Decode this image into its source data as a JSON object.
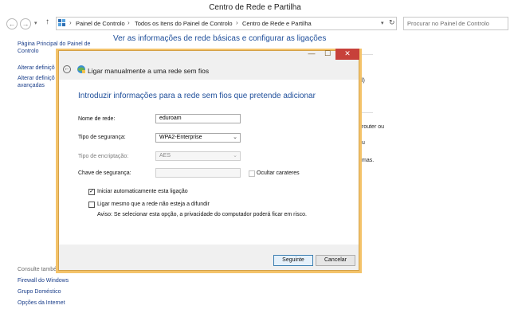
{
  "window": {
    "title": "Centro de Rede e Partilha",
    "nav": {
      "back": "←",
      "forward": "→",
      "dropdown": "▾",
      "up": "↑"
    },
    "breadcrumb": {
      "items": [
        "Painel de Controlo",
        "Todos os Itens do Painel de Controlo",
        "Centro de Rede e Partilha"
      ],
      "separator": "›",
      "dropdown": "▾",
      "refresh": "↻"
    },
    "search_placeholder": "Procurar no Painel de Controlo"
  },
  "sidebar": {
    "home_link": [
      "Página Principal do Painel de",
      "Controlo"
    ],
    "links": [
      "Alterar definiçõ",
      "Alterar definiçõ",
      "avançadas"
    ],
    "see_also": "Consulte també",
    "see_also_links": [
      "Firewall do Windows",
      "Grupo Doméstico",
      "Opções da Internet"
    ]
  },
  "main": {
    "heading": "Ver as informações de rede básicas e configurar as ligações",
    "fragments": [
      "l)",
      "router ou",
      "u",
      "mas."
    ]
  },
  "dialog": {
    "title": "Ligar manualmente a uma rede sem fios",
    "controls": {
      "minimize": "—",
      "maximize": "☐",
      "close": "✕"
    },
    "back": "←",
    "heading": "Introduzir informações para a rede sem fios que pretende adicionar",
    "fields": {
      "network_name": {
        "label": "Nome de rede:",
        "value": "eduroam"
      },
      "security_type": {
        "label": "Tipo de segurança:",
        "value": "WPA2-Enterprise"
      },
      "encryption_type": {
        "label": "Tipo de encriptação:",
        "value": "AES"
      },
      "security_key": {
        "label": "Chave de segurança:",
        "value": ""
      },
      "hide_chars": {
        "label": "Ocultar carateres",
        "checked": false
      }
    },
    "options": {
      "auto_start": {
        "label": "Iniciar automaticamente esta ligação",
        "checked": true
      },
      "connect_hidden": {
        "label": "Ligar mesmo que a rede não esteja a difundir",
        "checked": false
      },
      "warning": "Aviso: Se selecionar esta opção, a privacidade do computador poderá ficar em risco."
    },
    "buttons": {
      "next": "Seguinte",
      "cancel": "Cancelar"
    }
  },
  "icons": {
    "select_arrow": "⌄",
    "check": "✓"
  },
  "colors": {
    "dialog_frame": "#f4c36a",
    "close_button": "#c7413a",
    "heading_blue": "#1e4e9a",
    "link_blue": "#1a3e8a"
  }
}
